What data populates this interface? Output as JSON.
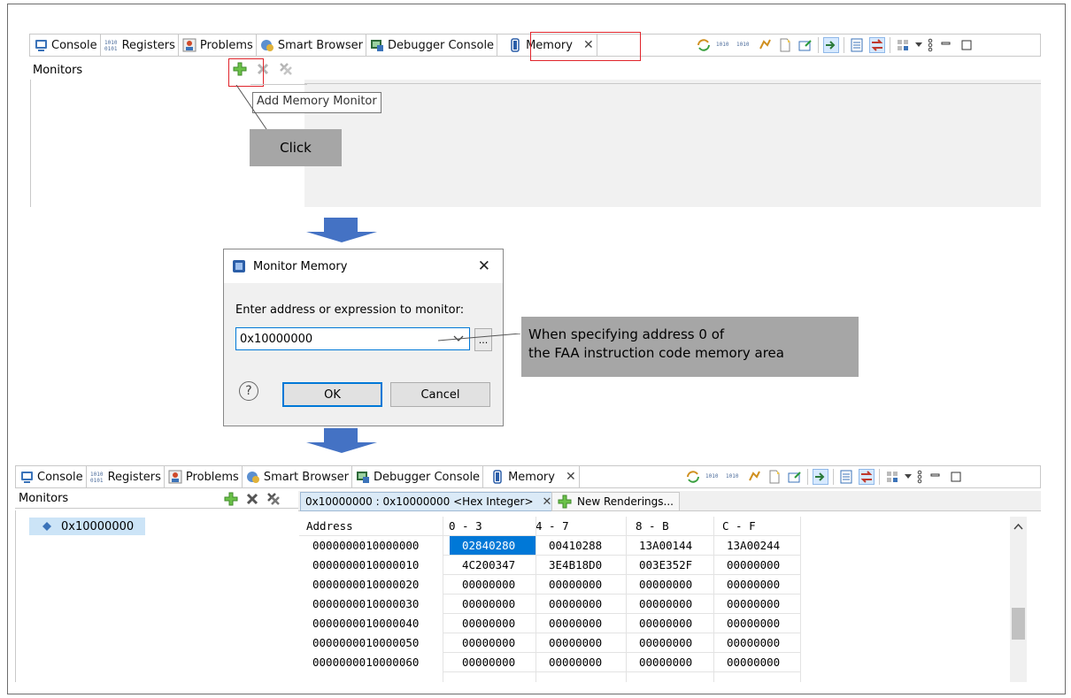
{
  "top_view": {
    "tabs": [
      {
        "label": "Console",
        "icon": "console-icon"
      },
      {
        "label": "Registers",
        "icon": "registers-icon"
      },
      {
        "label": "Problems",
        "icon": "problems-icon"
      },
      {
        "label": "Smart Browser",
        "icon": "smart-browser-icon"
      },
      {
        "label": "Debugger Console",
        "icon": "debugger-console-icon"
      },
      {
        "label": "Memory",
        "icon": "memory-icon"
      }
    ],
    "monitors_label": "Monitors",
    "tooltip": "Add Memory Monitor",
    "callout_click": "Click"
  },
  "dialog": {
    "title": "Monitor Memory",
    "prompt": "Enter address or expression to monitor:",
    "address_value": "0x10000000",
    "browse_label": "...",
    "ok_label": "OK",
    "cancel_label": "Cancel",
    "help_glyph": "?"
  },
  "callout_address": {
    "line1": "When specifying address 0 of",
    "line2": "the FAA instruction code memory area"
  },
  "bottom_view": {
    "tabs": [
      {
        "label": "Console"
      },
      {
        "label": "Registers"
      },
      {
        "label": "Problems"
      },
      {
        "label": "Smart Browser"
      },
      {
        "label": "Debugger Console"
      },
      {
        "label": "Memory"
      }
    ],
    "monitors_label": "Monitors",
    "monitor_item": "0x10000000",
    "rendering_tab": "0x10000000 : 0x10000000 <Hex Integer>",
    "new_renderings": "New Renderings...",
    "columns": [
      "Address",
      "0 - 3",
      "4 - 7",
      "8 - B",
      "C - F"
    ],
    "rows": [
      [
        "0000000010000000",
        "02840280",
        "00410288",
        "13A00144",
        "13A00244"
      ],
      [
        "0000000010000010",
        "4C200347",
        "3E4B18D0",
        "003E352F",
        "00000000"
      ],
      [
        "0000000010000020",
        "00000000",
        "00000000",
        "00000000",
        "00000000"
      ],
      [
        "0000000010000030",
        "00000000",
        "00000000",
        "00000000",
        "00000000"
      ],
      [
        "0000000010000040",
        "00000000",
        "00000000",
        "00000000",
        "00000000"
      ],
      [
        "0000000010000050",
        "00000000",
        "00000000",
        "00000000",
        "00000000"
      ],
      [
        "0000000010000060",
        "00000000",
        "00000000",
        "00000000",
        "00000000"
      ]
    ]
  },
  "colors": {
    "highlight_red": "#e0242b",
    "callout_grey": "#a6a6a6",
    "arrow_blue": "#4472c4",
    "selection_blue": "#0078d7"
  }
}
